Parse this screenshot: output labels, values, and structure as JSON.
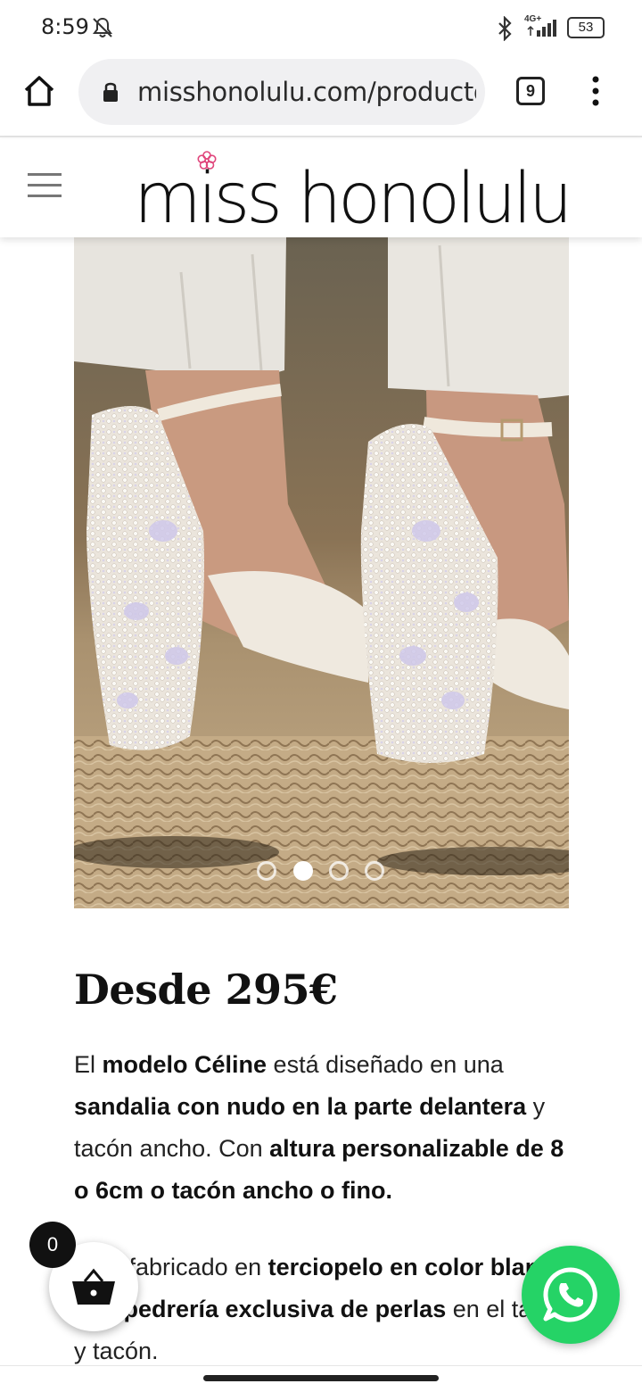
{
  "status_bar": {
    "time": "8:59",
    "network": "4G+",
    "battery": "53",
    "icons": [
      "mute-notifications-icon",
      "bluetooth-icon",
      "signal-icon",
      "battery-icon"
    ]
  },
  "browser": {
    "url": "misshonolulu.com/producto-",
    "tab_count": "9",
    "icons": [
      "home-icon",
      "lock-icon",
      "overflow-menu-icon"
    ]
  },
  "site": {
    "logo_text": "miss honolulu",
    "brand_color": "#e0457b"
  },
  "product": {
    "image_alt": "",
    "carousel": {
      "count": 4,
      "active_index": 1
    },
    "price": "Desde 295€",
    "description_1": [
      {
        "text": "El ",
        "bold": false
      },
      {
        "text": "modelo Céline",
        "bold": true
      },
      {
        "text": " está diseñado en una ",
        "bold": false
      },
      {
        "text": "sandalia con nudo en la parte delantera",
        "bold": true
      },
      {
        "text": " y tacón ancho. Con ",
        "bold": false
      },
      {
        "text": "altura personalizable de 8 o 6cm o tacón ancho o fino.",
        "bold": true
      }
    ],
    "description_2": [
      {
        "text": "Está fabricado en ",
        "bold": false
      },
      {
        "text": "terciopelo en color blanco con pedrería exclusiva de perlas",
        "bold": true
      },
      {
        "text": " en el talón y tacón.",
        "bold": false
      }
    ]
  },
  "cart": {
    "count": "0"
  },
  "whatsapp": {
    "color": "#25d366"
  }
}
